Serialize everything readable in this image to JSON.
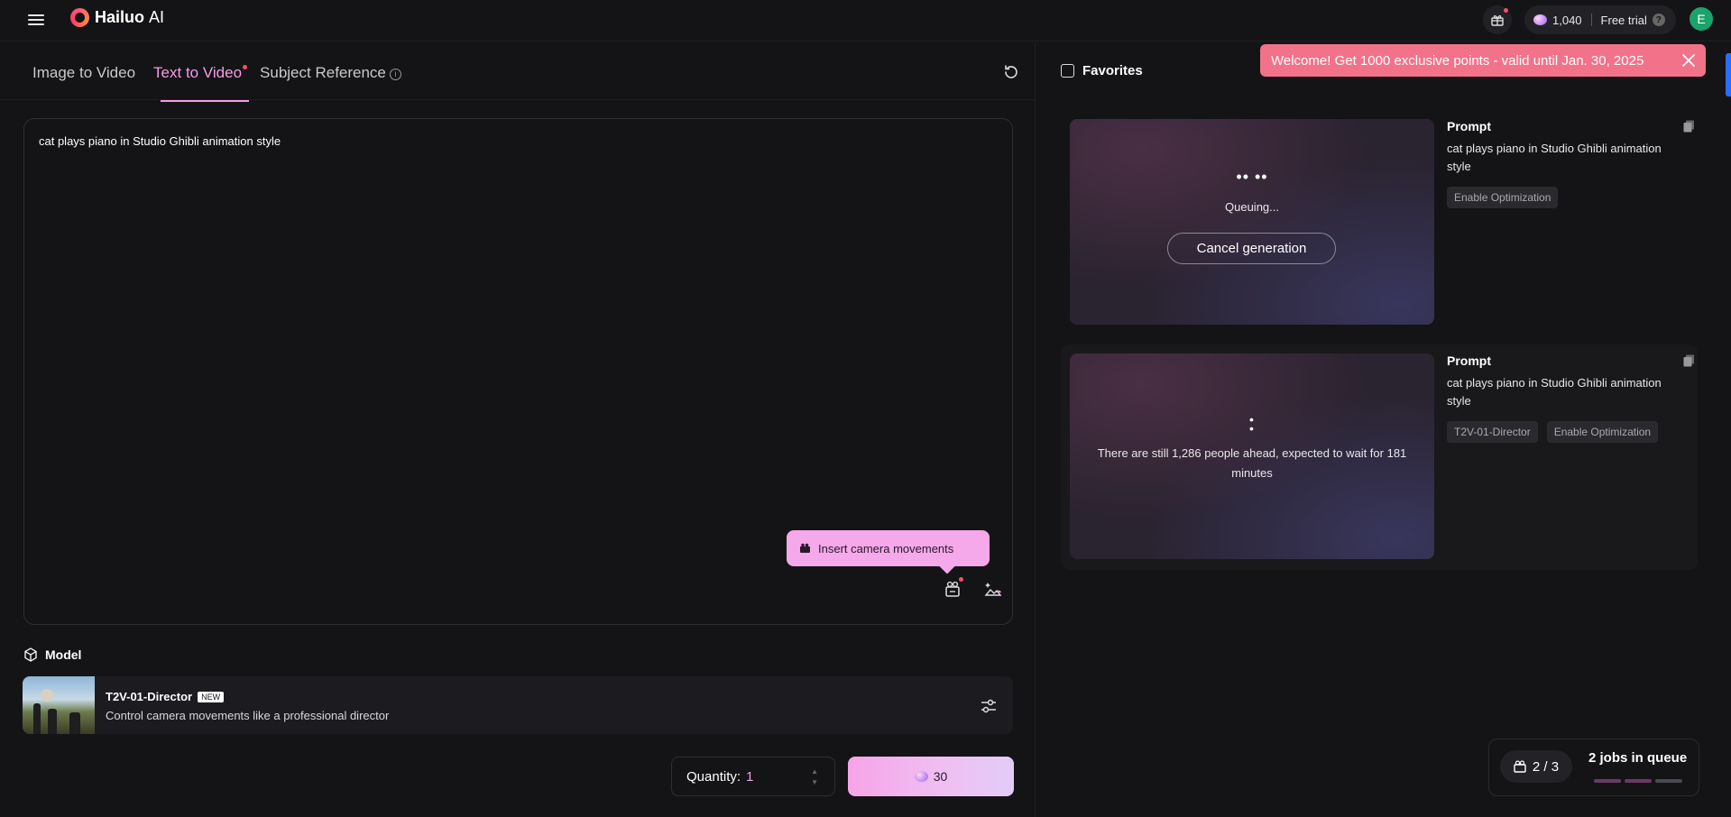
{
  "header": {
    "logo_brand": "Hailuo",
    "logo_suffix": "AI",
    "points": "1,040",
    "free_trial": "Free trial",
    "help_glyph": "?",
    "avatar_initial": "E"
  },
  "tabs": [
    {
      "label": "Image to Video",
      "active": false
    },
    {
      "label": "Text to Video",
      "active": true
    },
    {
      "label": "Subject Reference",
      "active": false
    }
  ],
  "prompt": {
    "value": "cat plays piano in Studio Ghibli animation style"
  },
  "tooltip": {
    "label": "Insert camera movements"
  },
  "model": {
    "section_label": "Model",
    "name": "T2V-01-Director",
    "badge": "NEW",
    "description": "Control camera movements like a professional director"
  },
  "quantity": {
    "label": "Quantity:",
    "value": "1"
  },
  "generate": {
    "cost": "30"
  },
  "right": {
    "favorites_label": "Favorites",
    "welcome_banner": "Welcome! Get 1000 exclusive points - valid until Jan. 30, 2025"
  },
  "jobs": [
    {
      "dots": "•• ••",
      "status": "Queuing...",
      "cancel_label": "Cancel generation",
      "prompt_title": "Prompt",
      "prompt_text": "cat plays piano in Studio Ghibli animation style",
      "tags": [
        "Enable Optimization"
      ]
    },
    {
      "dots": "•\n•",
      "status": "There are still 1,286 people ahead, expected to wait for 181 minutes",
      "prompt_title": "Prompt",
      "prompt_text": "cat plays piano in Studio Ghibli animation style",
      "tags": [
        "T2V-01-Director",
        "Enable Optimization"
      ]
    }
  ],
  "queue": {
    "count": "2 / 3",
    "label": "2 jobs in queue",
    "bar_colors": [
      "#6b3a63",
      "#6b3a63",
      "#4a4a50"
    ]
  },
  "colors": {
    "accent_pink": "#f59be6",
    "banner": "#f2728a",
    "background": "#141416",
    "notification_dot": "#ff4d6a"
  },
  "icons": {
    "menu": "hamburger-icon",
    "reset": "refresh-icon",
    "camera": "camera-movement-icon",
    "settings": "sliders-icon"
  }
}
